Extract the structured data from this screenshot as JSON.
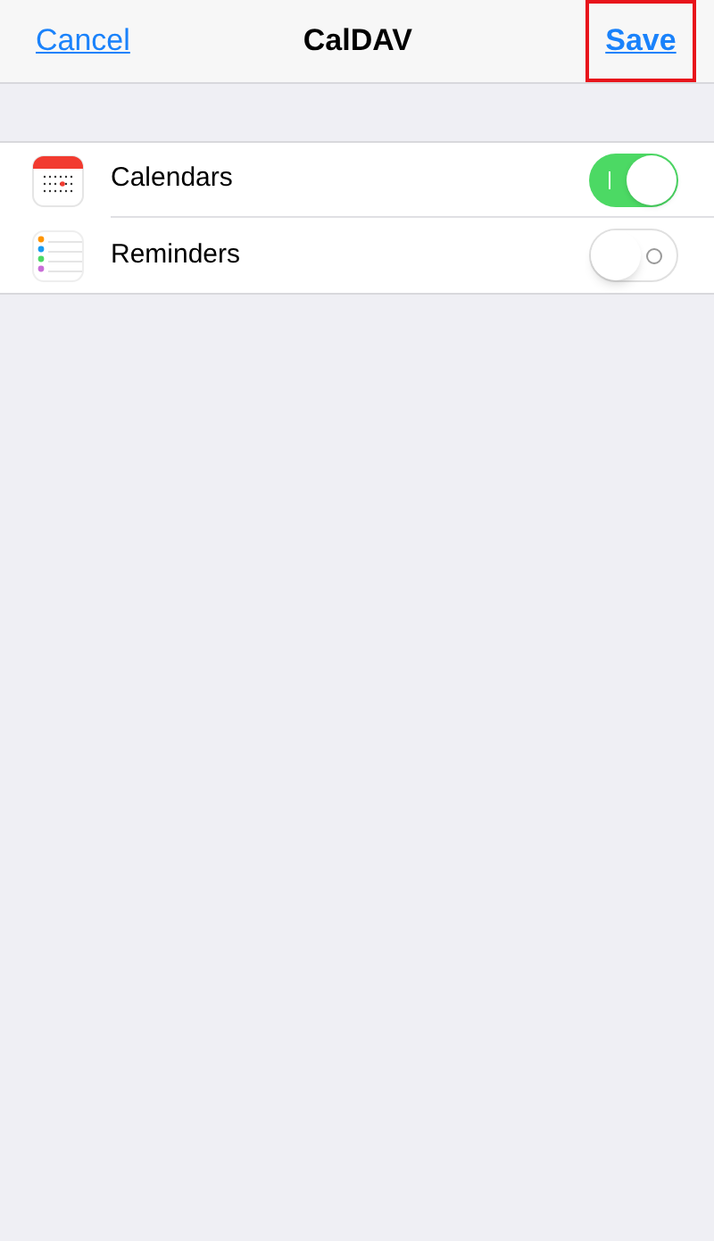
{
  "nav_bar": {
    "cancel": "Cancel",
    "title": "CalDAV",
    "save": {
      "label": "Save",
      "highlighted": true
    }
  },
  "rows": [
    {
      "kind": "calendar",
      "label": "Calendars",
      "on": true
    },
    {
      "kind": "reminders",
      "label": "Reminders",
      "on": false
    }
  ]
}
